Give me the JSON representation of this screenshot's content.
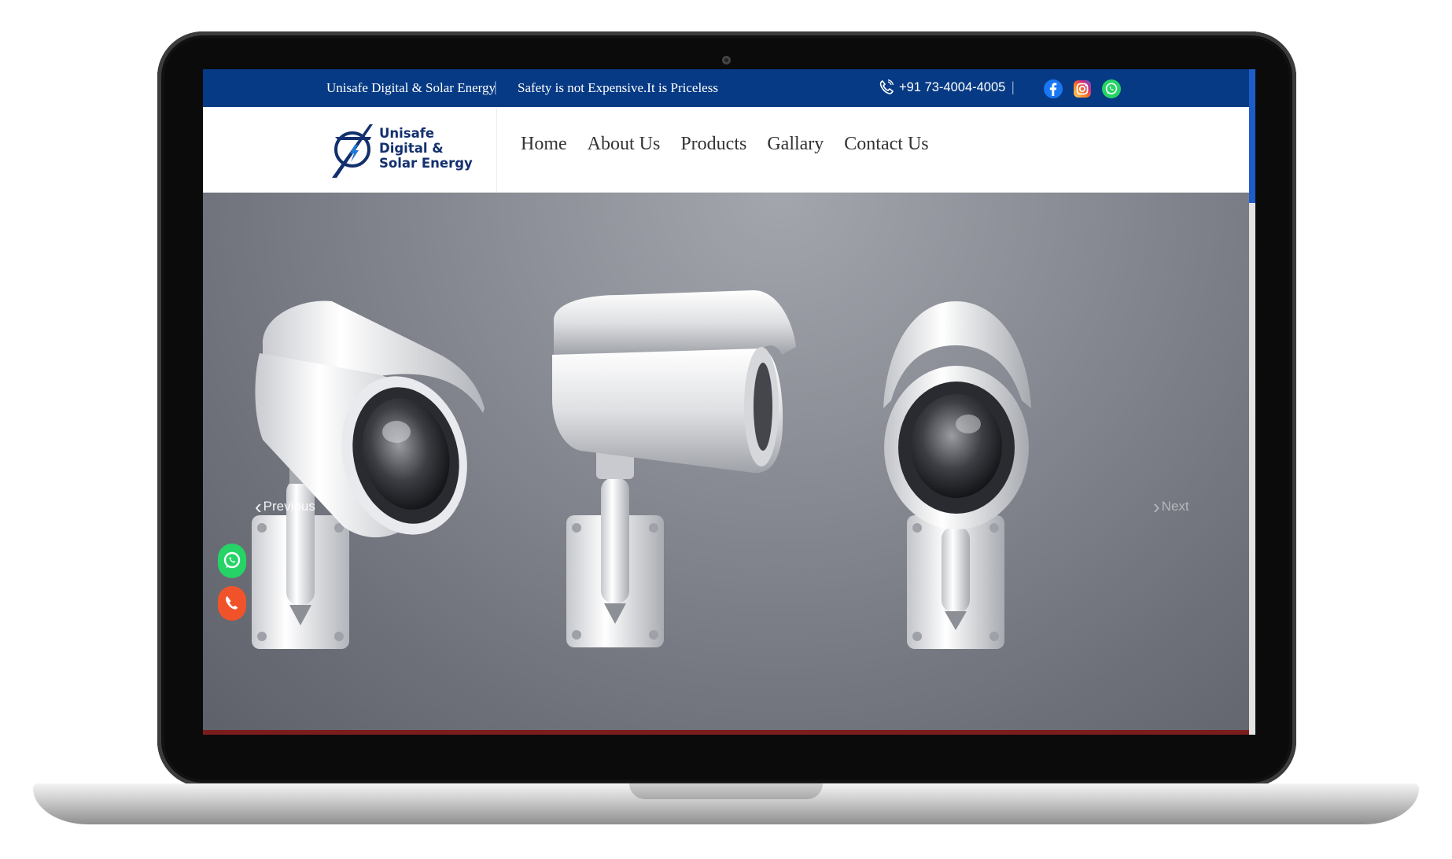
{
  "topbar": {
    "company_name": "Unisafe Digital & Solar Energy",
    "tagline": "Safety is not Expensive.It is Priceless",
    "separator": "|",
    "phone": "+91 73-4004-4005",
    "background_color": "#073a84"
  },
  "social": [
    {
      "name": "facebook-icon",
      "color": "#1877f2"
    },
    {
      "name": "instagram-icon",
      "color": "#e4405f"
    },
    {
      "name": "whatsapp-icon",
      "color": "#25d366"
    }
  ],
  "logo": {
    "line1": "Unisafe",
    "line2": "Digital &",
    "line3": "Solar Energy",
    "color": "#13306e"
  },
  "nav": {
    "items": [
      {
        "label": "Home"
      },
      {
        "label": "About Us"
      },
      {
        "label": "Products"
      },
      {
        "label": "Gallary"
      },
      {
        "label": "Contact Us"
      }
    ]
  },
  "carousel": {
    "previous_label": "Previous",
    "next_label": "Next"
  },
  "floating_buttons": {
    "whatsapp_color": "#25d366",
    "call_color": "#f0532a"
  }
}
